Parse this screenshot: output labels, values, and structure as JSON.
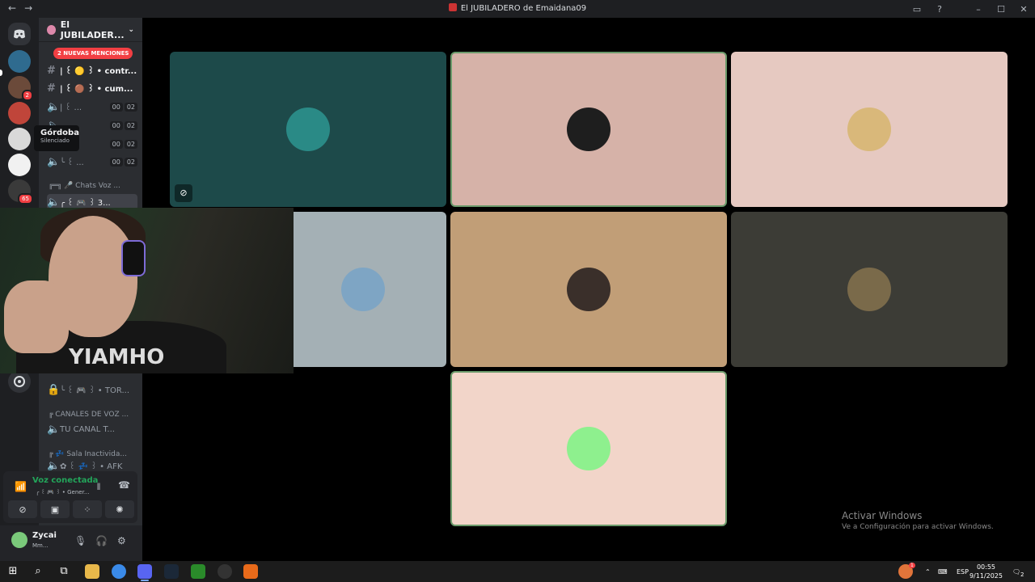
{
  "window": {
    "title": "El JUBILADERO de Emaidana09",
    "back": "←",
    "forward": "→",
    "controls": [
      "▭",
      "?",
      "–",
      "☐",
      "✕"
    ]
  },
  "guild": {
    "name": "El JUBILADER...",
    "mentions_badge": "2 NUEVAS MENCIONES",
    "channels": [
      {
        "icon": "#",
        "label": "| ꒰ 🟡 ꒱ • contr...",
        "bright": true
      },
      {
        "icon": "#",
        "label": "| ꒰ 🟤 ꒱ • cum...",
        "bright": true
      },
      {
        "icon": "🔈",
        "label": "| ꒰ ...",
        "c1": "00",
        "c2": "02"
      },
      {
        "icon": "🔈",
        "label": "...",
        "c1": "00",
        "c2": "02"
      },
      {
        "icon": "🔈",
        "label": "...",
        "c1": "00",
        "c2": "02"
      },
      {
        "icon": "🔈",
        "label": "╰ ꒰ ...",
        "c1": "00",
        "c2": "02"
      }
    ],
    "category_chats": "╔═╗ 🎤 Chats Voz ...",
    "active_channel": "╭ ꒰ 🎮 ꒱ 3...",
    "locked_channel": "╰ ꒰ 🎮 ꒱ • TOR...",
    "category_voice": "╔ CANALES DE VOZ ...",
    "voice_channel": "TU CANAL T...",
    "category_inactive": "╔ 💤 Sala Inactivida...",
    "afk_channel": "✿ ꒰ 💤 ꒱ • AFK"
  },
  "tooltip": {
    "name": "Górdoba",
    "status": "Silenciado"
  },
  "voice": {
    "status": "Voz conectada",
    "channel": "╭ ꒰ 🎮 ꒱ • Gener..."
  },
  "user": {
    "name": "Zycai",
    "status": "Mm..."
  },
  "server_badges": {
    "s2": "2",
    "s6": "65"
  },
  "watermark": {
    "line1": "Activar Windows",
    "line2": "Ve a Configuración para activar Windows."
  },
  "webcam": {
    "shirt_text": "YIAMHO"
  },
  "taskbar": {
    "lang": "ESP",
    "time": "00:55",
    "date": "9/11/2025",
    "notif": "2",
    "weather_badge": "1"
  },
  "colors": {
    "tile1": "#1d4a4a",
    "tile2": "#d6b2a8",
    "tile3": "#e6c9c1",
    "tile4": "#a4b0b5",
    "tile5": "#c19e77",
    "tile6": "#3c3c36",
    "tile7": "#f2d5c9",
    "speaking": "#6b9a6b",
    "voice_green": "#23a55a"
  }
}
